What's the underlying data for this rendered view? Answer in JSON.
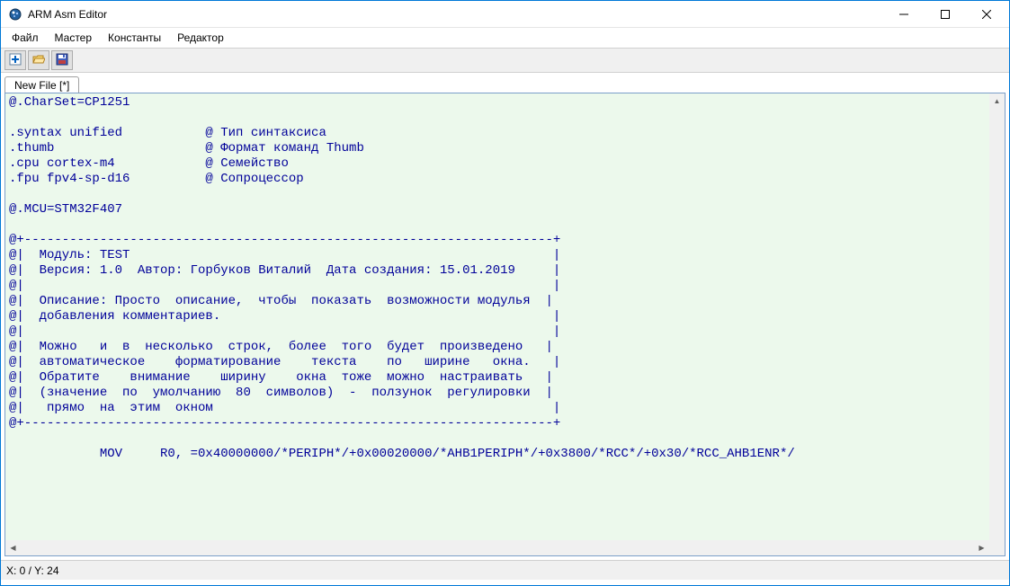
{
  "window": {
    "title": "ARM Asm Editor"
  },
  "menubar": {
    "file": "Файл",
    "master": "Мастер",
    "constants": "Константы",
    "editor": "Редактор"
  },
  "toolbar": {
    "new_tooltip": "New",
    "open_tooltip": "Open",
    "save_tooltip": "Save"
  },
  "tabs": [
    {
      "label": "New File [*]"
    }
  ],
  "editor": {
    "lines": [
      "@.CharSet=CP1251",
      "",
      ".syntax unified           @ Тип синтаксиса",
      ".thumb                    @ Формат команд Thumb",
      ".cpu cortex-m4            @ Семейство",
      ".fpu fpv4-sp-d16          @ Сопроцессор",
      "",
      "@.MCU=STM32F407",
      "",
      "@+----------------------------------------------------------------------+",
      "@|  Модуль: TEST                                                        |",
      "@|  Версия: 1.0  Автор: Горбуков Виталий  Дата создания: 15.01.2019     |",
      "@|                                                                      |",
      "@|  Описание: Просто  описание,  чтобы  показать  возможности модулья  |",
      "@|  добавления комментариев.                                            |",
      "@|                                                                      |",
      "@|  Можно   и  в  несколько  строк,  более  того  будет  произведено   |",
      "@|  автоматическое    форматирование    текста    по   ширине   окна.   |",
      "@|  Обратите    внимание    ширину    окна  тоже  можно  настраивать   |",
      "@|  (значение  по  умолчанию  80  символов)  -  ползунок  регулировки  |",
      "@|   прямо  на  этим  окном                                             |",
      "@+----------------------------------------------------------------------+",
      "",
      "            MOV     R0, =0x40000000/*PERIPH*/+0x00020000/*AHB1PERIPH*/+0x3800/*RCC*/+0x30/*RCC_AHB1ENR*/"
    ]
  },
  "status": {
    "position": "X: 0 / Y: 24"
  },
  "colors": {
    "editor_bg": "#ecf9ec",
    "comment_fg": "#000099"
  }
}
